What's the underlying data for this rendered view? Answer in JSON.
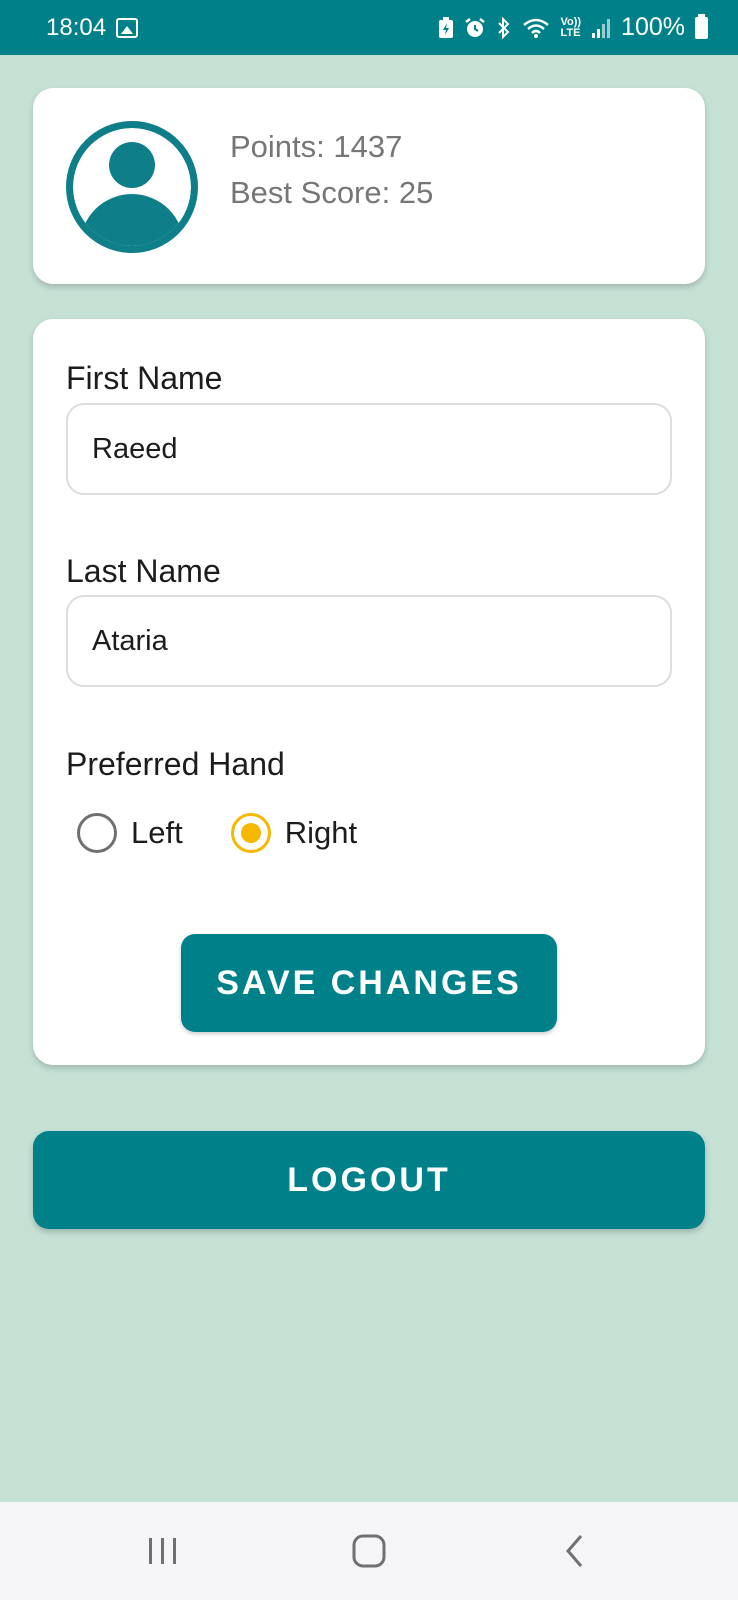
{
  "status_bar": {
    "time": "18:04",
    "network": "LTE",
    "volte": "Vo))",
    "battery": "100%"
  },
  "profile": {
    "points": "Points: 1437",
    "best_score": "Best Score: 25"
  },
  "form": {
    "first_name_label": "First Name",
    "first_name_value": "Raeed",
    "last_name_label": "Last Name",
    "last_name_value": "Ataria",
    "hand_label": "Preferred Hand",
    "hand_options": [
      {
        "label": "Left",
        "selected": false
      },
      {
        "label": "Right",
        "selected": true
      }
    ],
    "save_label": "SAVE CHANGES"
  },
  "logout_label": "LOGOUT",
  "colors": {
    "primary": "#00818a",
    "background": "#c4e1d4",
    "radio_selected": "#f5b800"
  },
  "nav": {
    "icons": [
      "recent-apps-icon",
      "home-icon",
      "back-icon"
    ]
  }
}
